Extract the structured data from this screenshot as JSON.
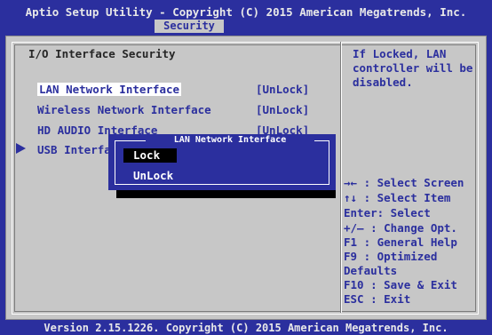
{
  "header": {
    "title": "Aptio Setup Utility - Copyright (C) 2015 American Megatrends, Inc.",
    "active_tab": "Security"
  },
  "page": {
    "heading": "I/O Interface Security",
    "items": [
      {
        "label": "LAN Network Interface",
        "value": "[UnLock]"
      },
      {
        "label": "Wireless Network Interface",
        "value": "[UnLock]"
      },
      {
        "label": "HD AUDIO Interface",
        "value": "[UnLock]"
      },
      {
        "label": "USB Interface Security",
        "value": ""
      }
    ]
  },
  "popup": {
    "title": "LAN Network Interface",
    "options": [
      "Lock",
      "UnLock"
    ],
    "selected": "Lock"
  },
  "help": {
    "description": "If Locked, LAN controller will be disabled.",
    "keys": [
      "→← : Select Screen",
      "↑↓  : Select Item",
      "Enter: Select",
      "+/—  : Change Opt.",
      "F1   : General Help",
      "F9   : Optimized",
      "Defaults",
      "F10  : Save & Exit",
      "ESC  : Exit"
    ]
  },
  "footer": {
    "text": "Version 2.15.1226. Copyright (C) 2015 American Megatrends, Inc."
  },
  "colors": {
    "blue": "#2B2F9E",
    "gray": "#C7C7C7"
  }
}
